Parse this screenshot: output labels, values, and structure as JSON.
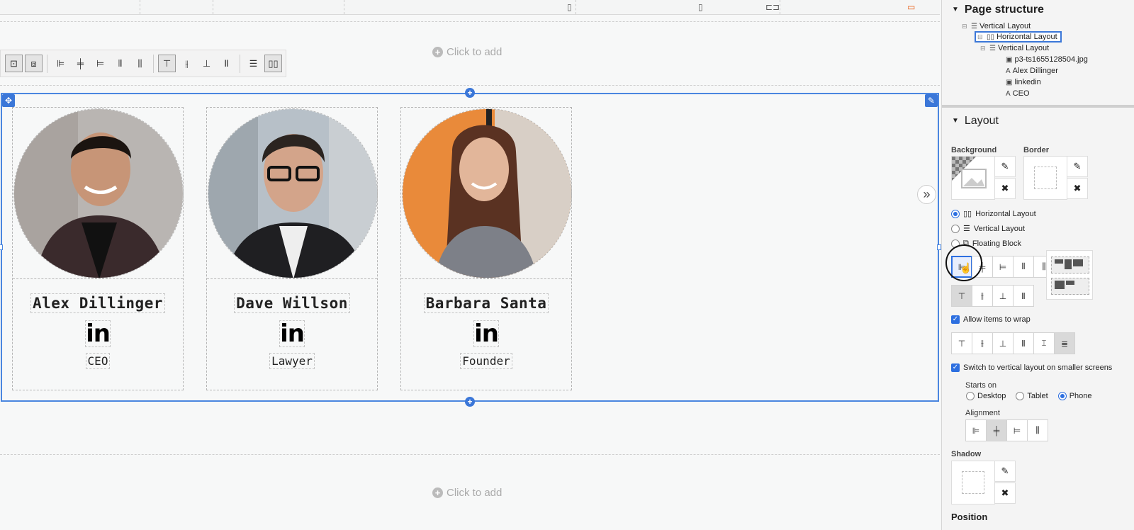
{
  "canvas": {
    "click_to_add_top": "Click to add",
    "click_to_add_bottom": "Click to add",
    "devices": [
      "phone-icon",
      "tablet-icon",
      "laptop-icon",
      "desktop-icon"
    ],
    "accent_color": "#3b77d8"
  },
  "toolbar": {
    "icons": [
      "resize-in-icon",
      "resize-center-icon",
      "align-left-icon",
      "align-center-icon",
      "align-right-icon",
      "space-between-icon",
      "space-around-icon",
      "valign-top-icon",
      "valign-middle-icon",
      "valign-bottom-icon",
      "valign-stretch-icon",
      "vertical-layout-icon",
      "horizontal-layout-icon"
    ]
  },
  "cards": [
    {
      "name": "Alex Dillinger",
      "social": "in",
      "role": "CEO"
    },
    {
      "name": "Dave Willson",
      "social": "in",
      "role": "Lawyer"
    },
    {
      "name": "Barbara Santa",
      "social": "in",
      "role": "Founder"
    }
  ],
  "panel": {
    "page_structure_title": "Page structure",
    "tree": [
      {
        "label": "Vertical Layout",
        "icon": "vertical-layout-icon"
      },
      {
        "label": "Horizontal Layout",
        "icon": "horizontal-layout-icon",
        "selected": true
      },
      {
        "label": "Vertical Layout",
        "icon": "vertical-layout-icon"
      },
      {
        "label": "p3-ts1655128504.jpg",
        "icon": "image-icon"
      },
      {
        "label": "Alex Dillinger",
        "icon": "text-icon"
      },
      {
        "label": "linkedin",
        "icon": "image-icon"
      },
      {
        "label": "CEO",
        "icon": "text-icon"
      }
    ],
    "layout_title": "Layout",
    "background_label": "Background",
    "border_label": "Border",
    "layout_options": [
      {
        "label": "Horizontal Layout",
        "checked": true
      },
      {
        "label": "Vertical Layout",
        "checked": false
      },
      {
        "label": "Floating Block",
        "checked": false
      }
    ],
    "allow_wrap_label": "Allow items to wrap",
    "switch_vertical_label": "Switch to vertical layout on smaller screens",
    "starts_on_label": "Starts on",
    "starts_on_options": [
      {
        "label": "Desktop",
        "checked": false
      },
      {
        "label": "Tablet",
        "checked": false
      },
      {
        "label": "Phone",
        "checked": true
      }
    ],
    "alignment_label": "Alignment",
    "shadow_label": "Shadow",
    "position_label": "Position"
  }
}
